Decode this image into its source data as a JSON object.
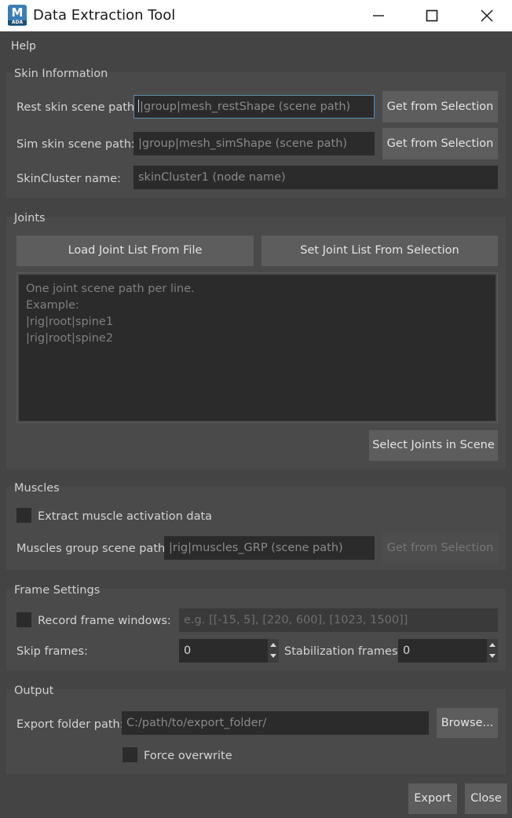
{
  "window": {
    "title": "Data Extraction Tool",
    "icon_letter": "M",
    "icon_sub": "ADA"
  },
  "menu": {
    "help": "Help"
  },
  "skin": {
    "title": "Skin Information",
    "rest_label": "Rest skin scene path:",
    "rest_placeholder": "|group|mesh_restShape (scene path)",
    "rest_button": "Get from Selection",
    "sim_label": "Sim skin scene path:",
    "sim_placeholder": "|group|mesh_simShape (scene path)",
    "sim_button": "Get from Selection",
    "skincluster_label": "SkinCluster name:",
    "skincluster_placeholder": "skinCluster1 (node name)"
  },
  "joints": {
    "title": "Joints",
    "load_button": "Load Joint List From File",
    "set_button": "Set Joint List From Selection",
    "placeholder_lines": [
      "One joint scene path per line.",
      "Example:",
      "|rig|root|spine1",
      "|rig|root|spine2"
    ],
    "select_button": "Select Joints in Scene"
  },
  "muscles": {
    "title": "Muscles",
    "extract_label": "Extract muscle activation data",
    "extract_checked": false,
    "group_label": "Muscles group scene path:",
    "group_placeholder": "|rig|muscles_GRP (scene path)",
    "group_button": "Get from Selection"
  },
  "frames": {
    "title": "Frame Settings",
    "record_label": "Record frame windows:",
    "record_checked": false,
    "record_placeholder": "e.g. [[-15, 5], [220, 600], [1023, 1500]]",
    "skip_label": "Skip frames:",
    "skip_value": "0",
    "stab_label": "Stabilization frames:",
    "stab_value": "0"
  },
  "output": {
    "title": "Output",
    "folder_label": "Export folder path:",
    "folder_placeholder": "C:/path/to/export_folder/",
    "browse_button": "Browse...",
    "overwrite_label": "Force overwrite",
    "overwrite_checked": false
  },
  "footer": {
    "export_button": "Export",
    "close_button": "Close"
  },
  "colors": {
    "background": "#444444",
    "group_bg": "#4a4a4a",
    "field_bg": "#2b2b2b",
    "button_bg": "#5d5d5d",
    "focus_border": "#5d8fb5",
    "titlebar_bg": "#ffffff"
  }
}
